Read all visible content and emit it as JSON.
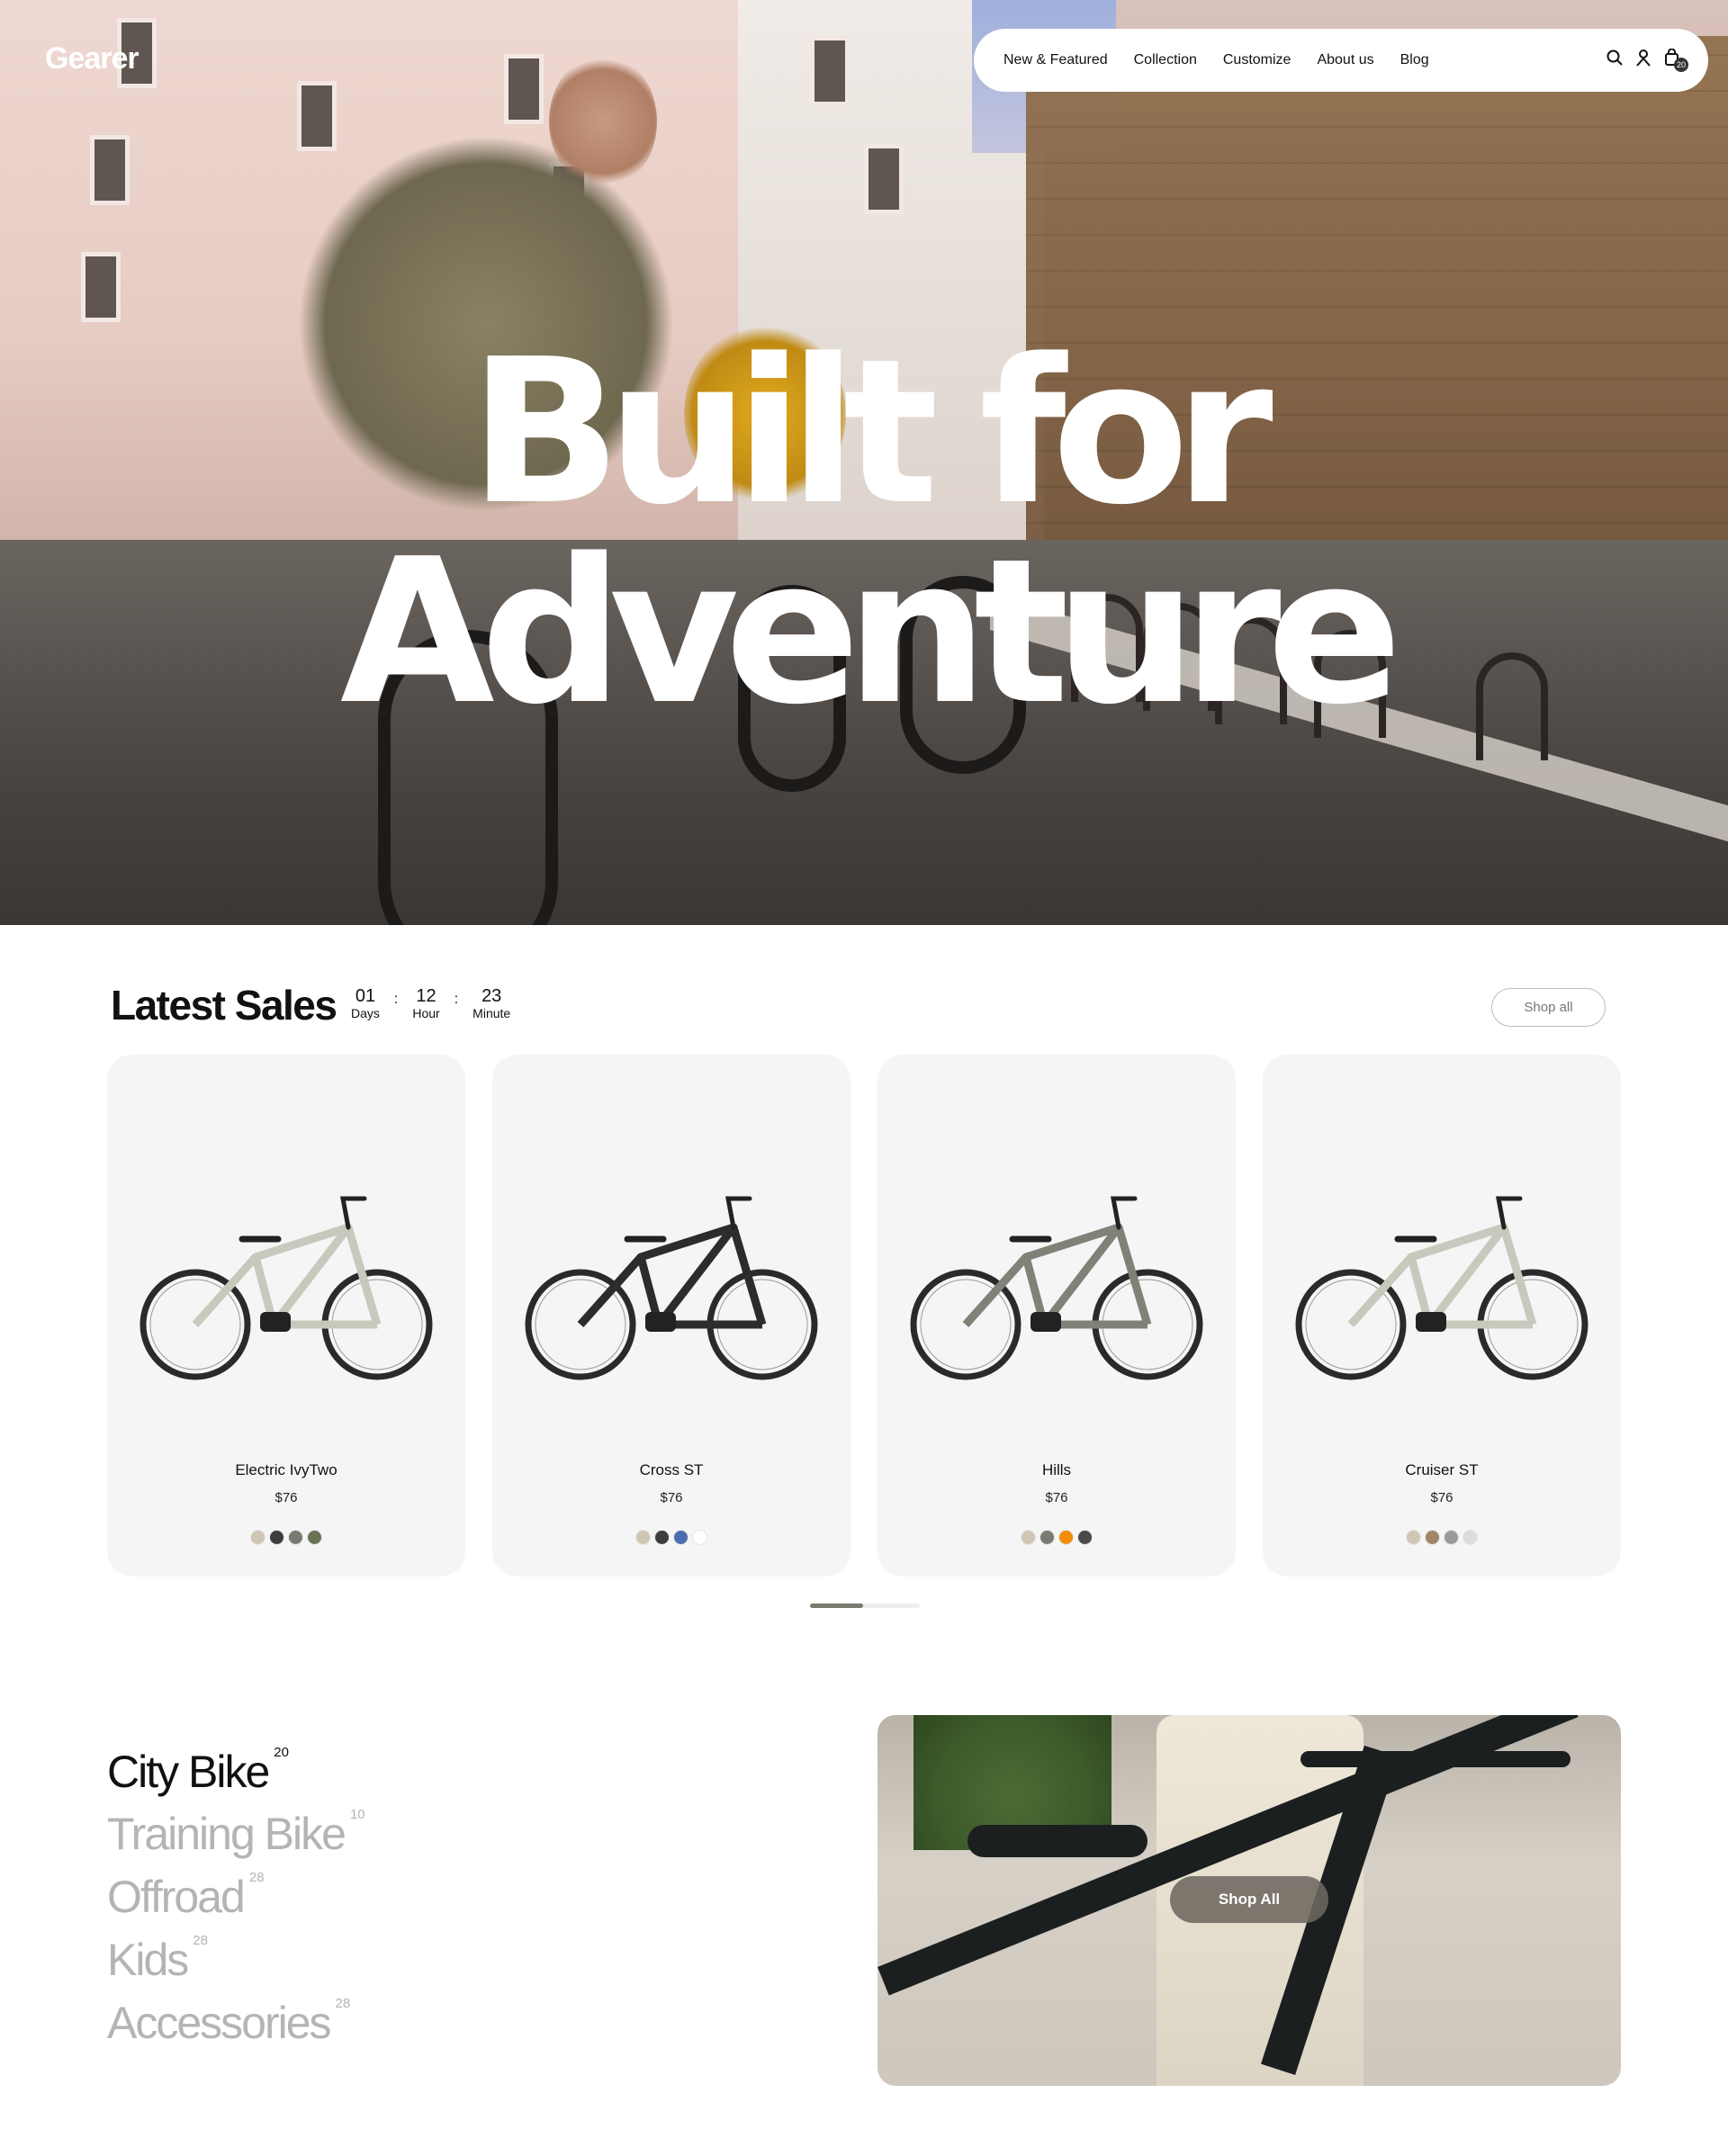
{
  "brand": {
    "logo": "Gearer"
  },
  "nav": {
    "links": [
      "New & Featured",
      "Collection",
      "Customize",
      "About us",
      "Blog"
    ],
    "icons": [
      "search-icon",
      "user-icon",
      "bag-icon"
    ],
    "cart_count": "20"
  },
  "hero": {
    "title": "Built for Adventure"
  },
  "sales": {
    "heading": "Latest Sales",
    "timer": [
      {
        "value": "01",
        "label": "Days"
      },
      {
        "value": "12",
        "label": "Hour"
      },
      {
        "value": "23",
        "label": "Minute"
      }
    ],
    "shop_all": "Shop all",
    "products": [
      {
        "name": "Electric IvyTwo",
        "price": "$76",
        "frame": "#c9c8bd",
        "colors": [
          "#cfc7b4",
          "#3d3d3d",
          "#7a7a73",
          "#6b7356"
        ]
      },
      {
        "name": "Cross ST",
        "price": "$76",
        "frame": "#2c2c2c",
        "colors": [
          "#cfc7b4",
          "#3d3d3d",
          "#4d6db3",
          "#ffffff"
        ]
      },
      {
        "name": "Hills",
        "price": "$76",
        "frame": "#7e8277",
        "colors": [
          "#cfc7b4",
          "#7a7a73",
          "#f28c0a",
          "#4a4a4a"
        ]
      },
      {
        "name": "Cruiser ST",
        "price": "$76",
        "frame": "#c6c9bc",
        "colors": [
          "#cfc7b4",
          "#a08567",
          "#9a9a9a",
          "#dcdcdc"
        ]
      }
    ],
    "pager_progress": 0.48
  },
  "categories": [
    {
      "label": "City Bike",
      "count": "20",
      "active": true
    },
    {
      "label": "Training Bike",
      "count": "10",
      "active": false
    },
    {
      "label": "Offroad",
      "count": "28",
      "active": false
    },
    {
      "label": "Kids",
      "count": "28",
      "active": false
    },
    {
      "label": "Accessories",
      "count": "28",
      "active": false
    }
  ],
  "promo": {
    "button": "Shop All"
  }
}
